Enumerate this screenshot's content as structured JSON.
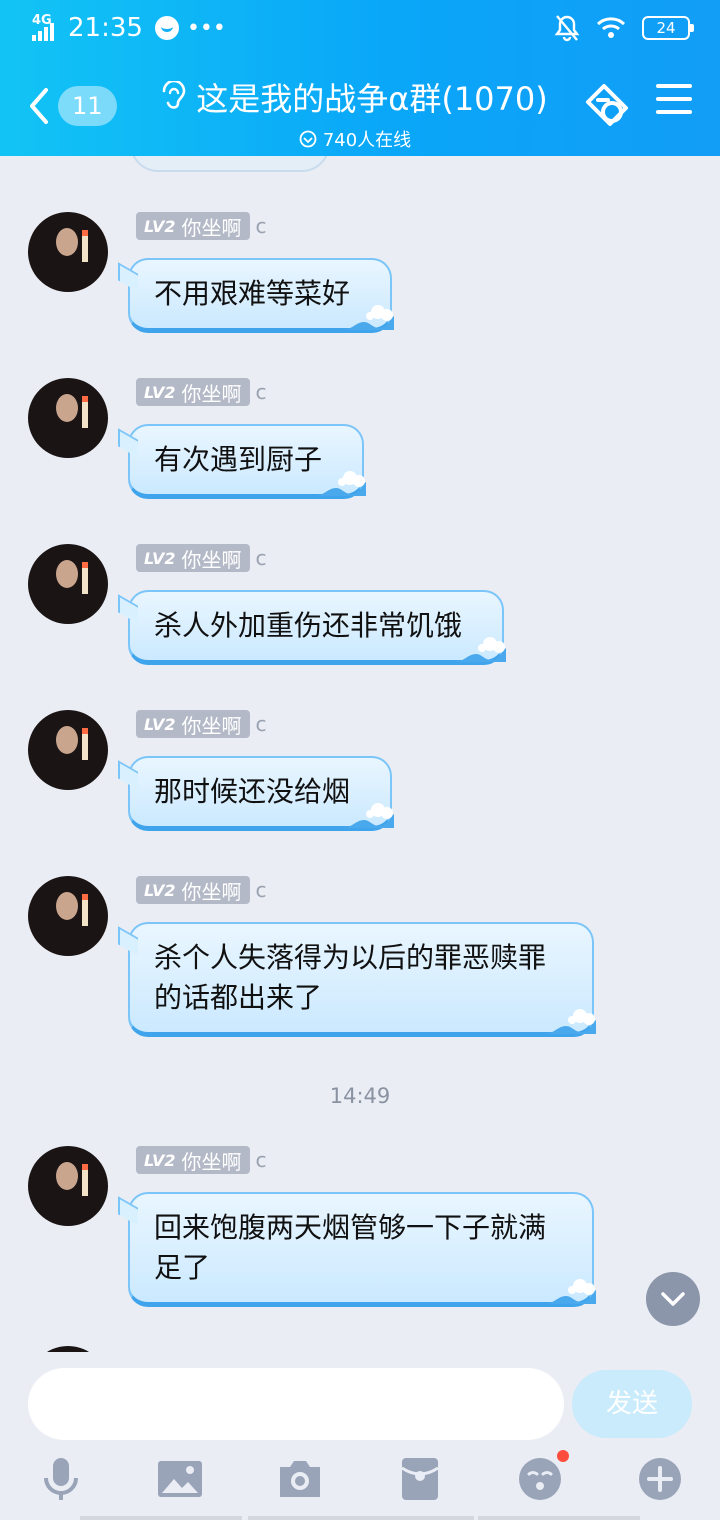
{
  "status_bar": {
    "network": "4G",
    "time": "21:35",
    "dots": "•••",
    "battery": "24"
  },
  "header": {
    "back_count": "11",
    "title": "这是我的战争α群(1070)",
    "online": "740人在线"
  },
  "messages": [
    {
      "level": "LV2",
      "name": "你坐啊",
      "tail": "c",
      "text": "不用艰难等菜好"
    },
    {
      "level": "LV2",
      "name": "你坐啊",
      "tail": "c",
      "text": "有次遇到厨子"
    },
    {
      "level": "LV2",
      "name": "你坐啊",
      "tail": "c",
      "text": "杀人外加重伤还非常饥饿"
    },
    {
      "level": "LV2",
      "name": "你坐啊",
      "tail": "c",
      "text": "那时候还没给烟"
    },
    {
      "level": "LV2",
      "name": "你坐啊",
      "tail": "c",
      "text": "杀个人失落得为以后的罪恶赎罪的话都出来了"
    },
    {
      "level": "LV2",
      "name": "你坐啊",
      "tail": "c",
      "text": "回来饱腹两天烟管够一下子就满足了"
    }
  ],
  "time_divider": "14:49",
  "input": {
    "placeholder": "",
    "send_label": "发送"
  },
  "toolbar": [
    "mic-icon",
    "image-icon",
    "camera-icon",
    "red-packet-icon",
    "emoji-icon",
    "plus-icon"
  ],
  "colors": {
    "header_start": "#12c4f5",
    "header_end": "#129df7",
    "bubble_border": "#3fa4eb",
    "background": "#eaedf4"
  }
}
